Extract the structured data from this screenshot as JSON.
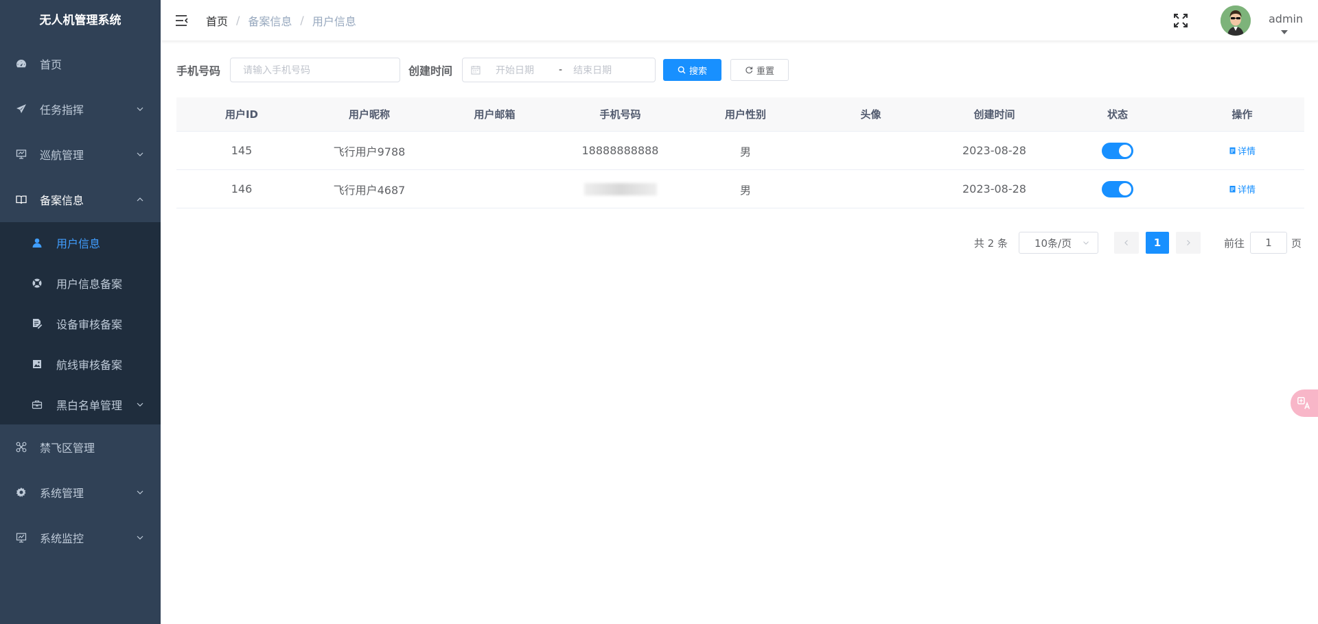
{
  "app": {
    "title": "无人机管理系统"
  },
  "sidebar": {
    "items": [
      {
        "label": "首页",
        "icon": "dashboard-icon"
      },
      {
        "label": "任务指挥",
        "icon": "send-icon"
      },
      {
        "label": "巡航管理",
        "icon": "monitor-icon"
      },
      {
        "label": "备案信息",
        "icon": "book-icon",
        "open": true,
        "children": [
          {
            "label": "用户信息",
            "icon": "user-icon",
            "active": true
          },
          {
            "label": "用户信息备案",
            "icon": "lifebuoy-icon"
          },
          {
            "label": "设备审核备案",
            "icon": "edit-doc-icon"
          },
          {
            "label": "航线审核备案",
            "icon": "image-icon"
          },
          {
            "label": "黑白名单管理",
            "icon": "briefcase-icon"
          }
        ]
      },
      {
        "label": "禁飞区管理",
        "icon": "drone-icon"
      },
      {
        "label": "系统管理",
        "icon": "gear-icon"
      },
      {
        "label": "系统监控",
        "icon": "chart-monitor-icon"
      }
    ]
  },
  "header": {
    "breadcrumb": [
      "首页",
      "备案信息",
      "用户信息"
    ],
    "breadcrumb_sep": "/",
    "username": "admin"
  },
  "search": {
    "phone_label": "手机号码",
    "phone_placeholder": "请输入手机号码",
    "created_label": "创建时间",
    "start_placeholder": "开始日期",
    "range_sep": "-",
    "end_placeholder": "结束日期",
    "search_button": "搜索",
    "reset_button": "重置"
  },
  "table": {
    "columns": [
      "用户ID",
      "用户昵称",
      "用户邮箱",
      "手机号码",
      "用户性别",
      "头像",
      "创建时间",
      "状态",
      "操作"
    ],
    "rows": [
      {
        "id": "145",
        "nickname": "飞行用户9788",
        "email": "",
        "phone": "18888888888",
        "gender": "男",
        "avatar": "",
        "created": "2023-08-28",
        "status": true,
        "action": "详情"
      },
      {
        "id": "146",
        "nickname": "飞行用户4687",
        "email": "",
        "phone": "",
        "gender": "男",
        "avatar": "",
        "created": "2023-08-28",
        "status": true,
        "action": "详情"
      }
    ]
  },
  "pagination": {
    "total_text": "共 2 条",
    "page_size": "10条/页",
    "current_page": "1",
    "goto_label": "前往",
    "goto_value": "1",
    "page_suffix": "页"
  },
  "colors": {
    "sidebar_bg": "#304156",
    "submenu_bg": "#1f2d3d",
    "primary": "#1890ff",
    "menu_text": "#bfcbd9"
  }
}
